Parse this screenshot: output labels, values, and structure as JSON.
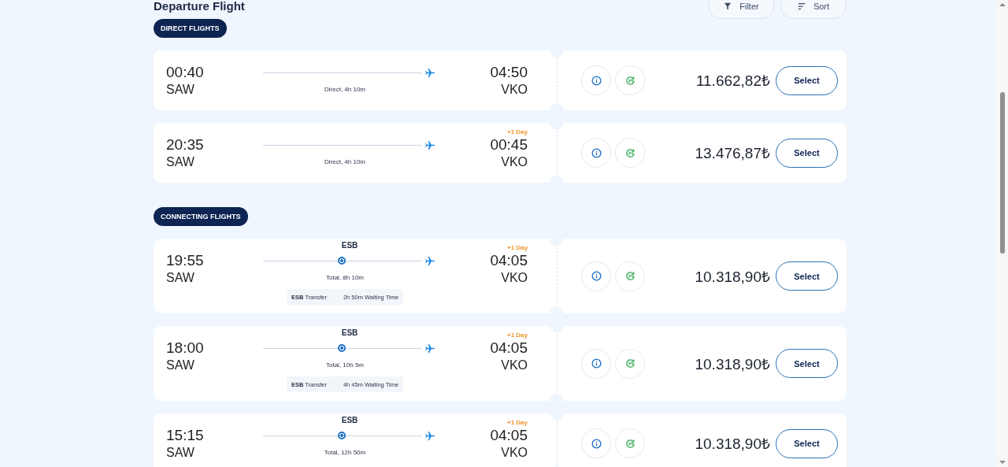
{
  "header": {
    "title": "Departure Flight",
    "buttons": [
      {
        "kind": "filter",
        "label": "Filter"
      },
      {
        "kind": "sort",
        "label": "Sort"
      }
    ]
  },
  "sections": [
    {
      "label": "DIRECT FLIGHTS",
      "flights": [
        {
          "dep_time": "00:40",
          "dep_airport": "SAW",
          "duration": "Direct, 4h 10m",
          "arr_time": "04:50",
          "arr_airport": "VKO",
          "price": "11.662,82₺",
          "button": "Select"
        },
        {
          "dep_time": "20:35",
          "dep_airport": "SAW",
          "duration": "Direct, 4h 10m",
          "day_offset": "+1 Day",
          "arr_time": "00:45",
          "arr_airport": "VKO",
          "price": "13.476,87₺",
          "button": "Select"
        }
      ]
    },
    {
      "label": "CONNECTING FLIGHTS",
      "flights": [
        {
          "dep_time": "19:55",
          "dep_airport": "SAW",
          "stop": "ESB",
          "duration": "Total, 8h 10m",
          "day_offset": "+1 Day",
          "arr_time": "04:05",
          "arr_airport": "VKO",
          "transfer": "**ESB** Transfer",
          "waiting": "2h 50m Waiting Time",
          "price": "10.318,90₺",
          "button": "Select"
        },
        {
          "dep_time": "18:00",
          "dep_airport": "SAW",
          "stop": "ESB",
          "duration": "Total, 10h 5m",
          "day_offset": "+1 Day",
          "arr_time": "04:05",
          "arr_airport": "VKO",
          "transfer": "**ESB** Transfer",
          "waiting": "4h 45m Waiting Time",
          "price": "10.318,90₺",
          "button": "Select"
        },
        {
          "dep_time": "15:15",
          "dep_airport": "SAW",
          "stop": "ESB",
          "duration": "Total, 12h 50m",
          "day_offset": "+1 Day",
          "arr_time": "04:05",
          "arr_airport": "VKO",
          "price": "10.318,90₺",
          "button": "Select"
        }
      ]
    }
  ]
}
